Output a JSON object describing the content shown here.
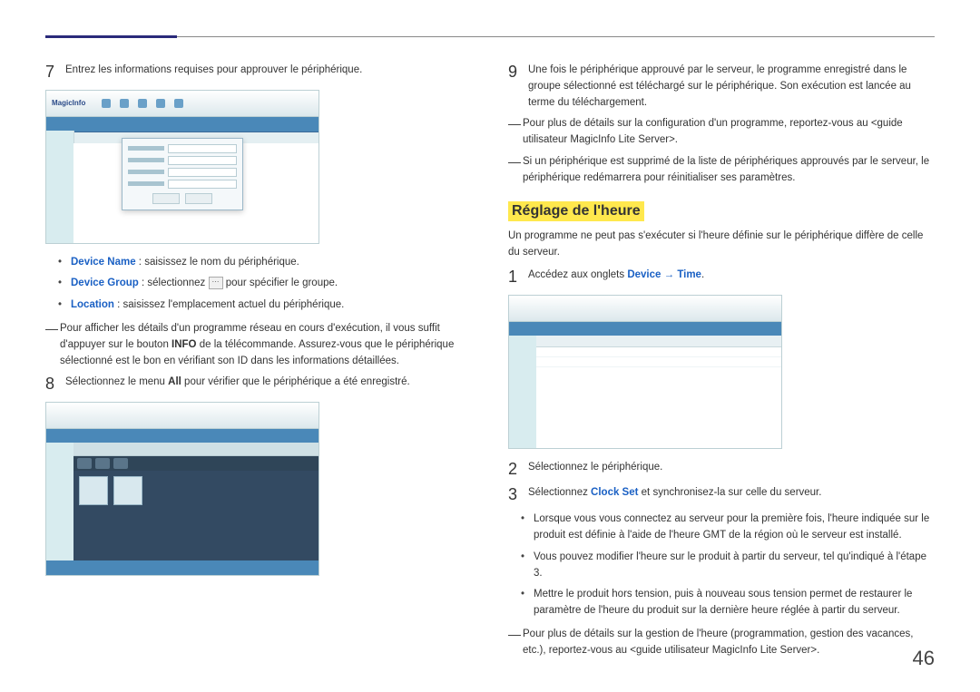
{
  "page_number": "46",
  "left": {
    "step7": {
      "num": "7",
      "text": "Entrez les informations requises pour approuver le périphérique."
    },
    "fields": {
      "device_name_label": "Device Name",
      "device_name_desc": " : saisissez le nom du périphérique.",
      "device_group_label": "Device Group",
      "device_group_desc_a": " : sélectionnez ",
      "device_group_desc_b": " pour spécifier le groupe.",
      "browse_glyph": "⋯",
      "location_label": "Location",
      "location_desc": " : saisissez l'emplacement actuel du périphérique."
    },
    "note_info": "Pour afficher les détails d'un programme réseau en cours d'exécution, il vous suffit d'appuyer sur le bouton INFO de la télécommande. Assurez-vous que le périphérique sélectionné est le bon en vérifiant son ID dans les informations détaillées.",
    "note_info_bold": "INFO",
    "step8": {
      "num": "8",
      "text_a": "Sélectionnez le menu ",
      "text_all": "All",
      "text_b": " pour vérifier que le périphérique a été enregistré."
    }
  },
  "right": {
    "step9": {
      "num": "9",
      "text": "Une fois le périphérique approuvé par le serveur, le programme enregistré dans le groupe sélectionné est téléchargé sur le périphérique. Son exécution est lancée au terme du téléchargement."
    },
    "note_a": "Pour plus de détails sur la configuration d'un programme, reportez-vous au <guide utilisateur MagicInfo Lite Server>.",
    "note_b": "Si un périphérique est supprimé de la liste de périphériques approuvés par le serveur, le périphérique redémarrera pour réinitialiser ses paramètres.",
    "heading": "Réglage de l'heure",
    "intro": "Un programme ne peut pas s'exécuter si l'heure définie sur le périphérique diffère de celle du serveur.",
    "step1": {
      "num": "1",
      "text_a": "Accédez aux onglets ",
      "device": "Device",
      "arrow": " → ",
      "time": "Time",
      "text_b": "."
    },
    "step2": {
      "num": "2",
      "text": "Sélectionnez le périphérique."
    },
    "step3": {
      "num": "3",
      "text_a": "Sélectionnez ",
      "clock_set": "Clock Set",
      "text_b": " et synchronisez-la sur celle du serveur."
    },
    "bullets": {
      "b1": "Lorsque vous vous connectez au serveur pour la première fois, l'heure indiquée sur le produit est définie à l'aide de l'heure GMT de la région où le serveur est installé.",
      "b2": "Vous pouvez modifier l'heure sur le produit à partir du serveur, tel qu'indiqué à l'étape 3.",
      "b3": "Mettre le produit hors tension, puis à nouveau sous tension permet de restaurer le paramètre de l'heure du produit sur la dernière heure réglée à partir du serveur."
    },
    "note_c": "Pour plus de détails sur la gestion de l'heure (programmation, gestion des vacances, etc.), reportez-vous au <guide utilisateur MagicInfo Lite Server>."
  },
  "screenshot_ui": {
    "logo": "MagicInfo"
  }
}
